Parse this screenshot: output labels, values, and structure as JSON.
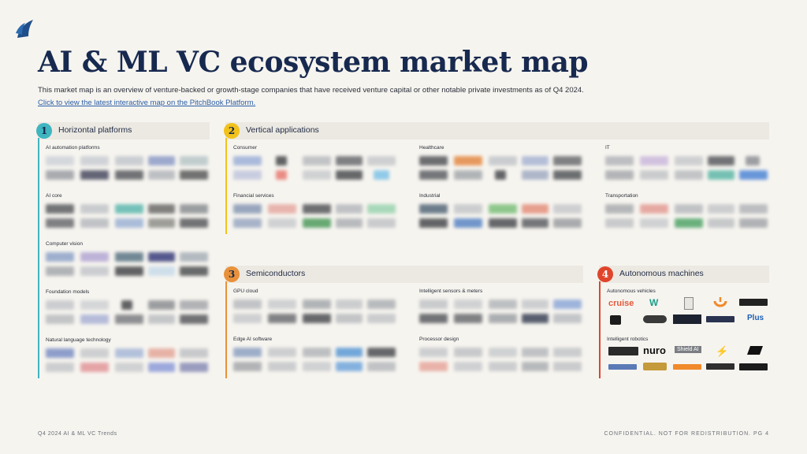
{
  "header": {
    "logo_icon": "pitchbook-sail-icon",
    "title": "AI & ML VC ecosystem market map",
    "subtitle": "This market map is an overview of venture-backed or growth-stage companies that have received venture capital or other notable private investments as of Q4 2024.",
    "link": "Click to view the latest interactive map on the PitchBook Platform."
  },
  "colors": {
    "section1": "#3fb5c0",
    "section2": "#f2c21b",
    "section3": "#e8913a",
    "section4": "#e0452c",
    "title": "#17294f"
  },
  "sections": [
    {
      "number": "1",
      "title": "Horizontal platforms",
      "categories": [
        {
          "label": "AI automation platforms"
        },
        {
          "label": "AI core"
        },
        {
          "label": "Computer vision"
        },
        {
          "label": "Foundation models"
        },
        {
          "label": "Natural language technology"
        }
      ]
    },
    {
      "number": "2",
      "title": "Vertical applications",
      "categories": [
        {
          "label": "Consumer"
        },
        {
          "label": "Healthcare"
        },
        {
          "label": "IT"
        },
        {
          "label": "Financial services"
        },
        {
          "label": "Industrial"
        },
        {
          "label": "Transportation"
        }
      ]
    },
    {
      "number": "3",
      "title": "Semiconductors",
      "categories": [
        {
          "label": "GPU cloud"
        },
        {
          "label": "Intelligent sensors & meters"
        },
        {
          "label": "Edge AI software"
        },
        {
          "label": "Processor design"
        }
      ]
    },
    {
      "number": "4",
      "title": "Autonomous machines",
      "categories": [
        {
          "label": "Autonomous vehicles",
          "logos": [
            "cruise",
            "W",
            "",
            "",
            "",
            "Plus"
          ]
        },
        {
          "label": "Intelligent robotics",
          "logos": [
            "",
            "nuro",
            "Shield AI",
            "",
            "",
            ""
          ]
        }
      ]
    }
  ],
  "footer": {
    "left": "Q4 2024 AI & ML VC Trends",
    "right": "CONFIDENTIAL. NOT FOR REDISTRIBUTION. PG 4"
  }
}
